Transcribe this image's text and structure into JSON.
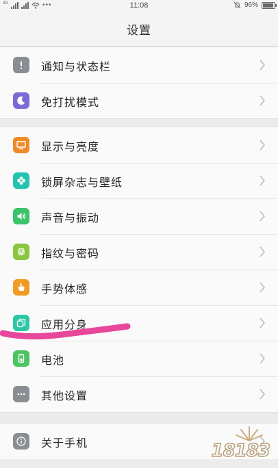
{
  "status_bar": {
    "network_label": "3G",
    "time": "11:08",
    "battery_percent": "96%",
    "battery_level": 0.96
  },
  "header": {
    "title": "设置"
  },
  "groups": [
    {
      "items": [
        {
          "label": "通知与状态栏",
          "icon": "exclamation-icon",
          "color": "#8a8d93"
        },
        {
          "label": "免打扰模式",
          "icon": "moon-icon",
          "color": "#7b6bd6"
        }
      ]
    },
    {
      "items": [
        {
          "label": "显示与亮度",
          "icon": "display-icon",
          "color": "#f08a28"
        },
        {
          "label": "锁屏杂志与壁纸",
          "icon": "flower-icon",
          "color": "#25c2b0"
        },
        {
          "label": "声音与振动",
          "icon": "speaker-icon",
          "color": "#3cc46a"
        },
        {
          "label": "指纹与密码",
          "icon": "fingerprint-icon",
          "color": "#8bc63f"
        },
        {
          "label": "手势体感",
          "icon": "hand-icon",
          "color": "#f29a26"
        },
        {
          "label": "应用分身",
          "icon": "clone-icon",
          "color": "#2cc7a6"
        },
        {
          "label": "电池",
          "icon": "battery-icon",
          "color": "#4bc462"
        },
        {
          "label": "其他设置",
          "icon": "more-icon",
          "color": "#8a8d93"
        }
      ]
    },
    {
      "items": [
        {
          "label": "关于手机",
          "icon": "info-icon",
          "color": "#8a8d93"
        }
      ]
    }
  ],
  "annotation": {
    "scribble_color": "#e8479b"
  },
  "watermark": {
    "text": "18183"
  }
}
